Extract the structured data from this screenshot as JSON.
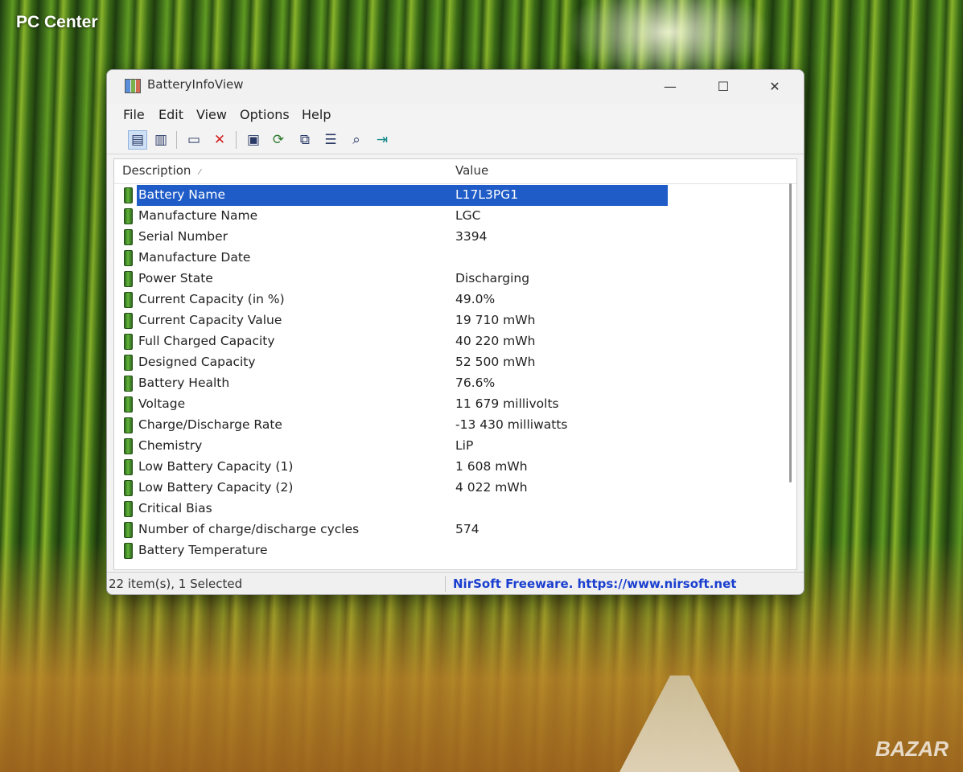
{
  "desktop": {
    "watermark_top": "PC Center",
    "watermark_bottom": "BAZAR"
  },
  "window": {
    "title": "BatteryInfoView",
    "controls": {
      "minimize": "—",
      "maximize": "☐",
      "close": "✕"
    }
  },
  "menu": {
    "items": [
      "File",
      "Edit",
      "View",
      "Options",
      "Help"
    ]
  },
  "toolbar": {
    "buttons": [
      {
        "icon": "details-view-icon",
        "glyph": "▤"
      },
      {
        "icon": "log-view-icon",
        "glyph": "▥"
      },
      {
        "icon": "window-icon",
        "glyph": "▭"
      },
      {
        "icon": "delete-icon",
        "glyph": "✕"
      },
      {
        "icon": "save-icon",
        "glyph": "▣"
      },
      {
        "icon": "refresh-icon",
        "glyph": "⟳"
      },
      {
        "icon": "copy-icon",
        "glyph": "⧉"
      },
      {
        "icon": "properties-icon",
        "glyph": "☰"
      },
      {
        "icon": "find-icon",
        "glyph": "⌕"
      },
      {
        "icon": "exit-icon",
        "glyph": "⇥"
      }
    ]
  },
  "list": {
    "columns": {
      "description": "Description",
      "value": "Value"
    },
    "rows": [
      {
        "description": "Battery Name",
        "value": "L17L3PG1"
      },
      {
        "description": "Manufacture Name",
        "value": "LGC"
      },
      {
        "description": "Serial Number",
        "value": "3394"
      },
      {
        "description": "Manufacture Date",
        "value": ""
      },
      {
        "description": "Power State",
        "value": "Discharging"
      },
      {
        "description": "Current Capacity (in %)",
        "value": "49.0%"
      },
      {
        "description": "Current Capacity Value",
        "value": "19 710 mWh"
      },
      {
        "description": "Full Charged Capacity",
        "value": "40 220 mWh"
      },
      {
        "description": "Designed Capacity",
        "value": "52 500 mWh"
      },
      {
        "description": "Battery Health",
        "value": "76.6%"
      },
      {
        "description": "Voltage",
        "value": "11 679 millivolts"
      },
      {
        "description": "Charge/Discharge Rate",
        "value": "-13 430 milliwatts"
      },
      {
        "description": "Chemistry",
        "value": "LiP"
      },
      {
        "description": "Low Battery Capacity (1)",
        "value": "1 608 mWh"
      },
      {
        "description": "Low Battery Capacity (2)",
        "value": "4 022 mWh"
      },
      {
        "description": "Critical Bias",
        "value": ""
      },
      {
        "description": "Number of charge/discharge cycles",
        "value": "574"
      },
      {
        "description": "Battery Temperature",
        "value": ""
      }
    ]
  },
  "statusbar": {
    "count": "22 item(s), 1 Selected",
    "link": "NirSoft Freeware. https://www.nirsoft.net"
  },
  "colors": {
    "selection": "#1f5cc8",
    "link": "#1a3fcf",
    "delete_icon": "#d22020"
  }
}
